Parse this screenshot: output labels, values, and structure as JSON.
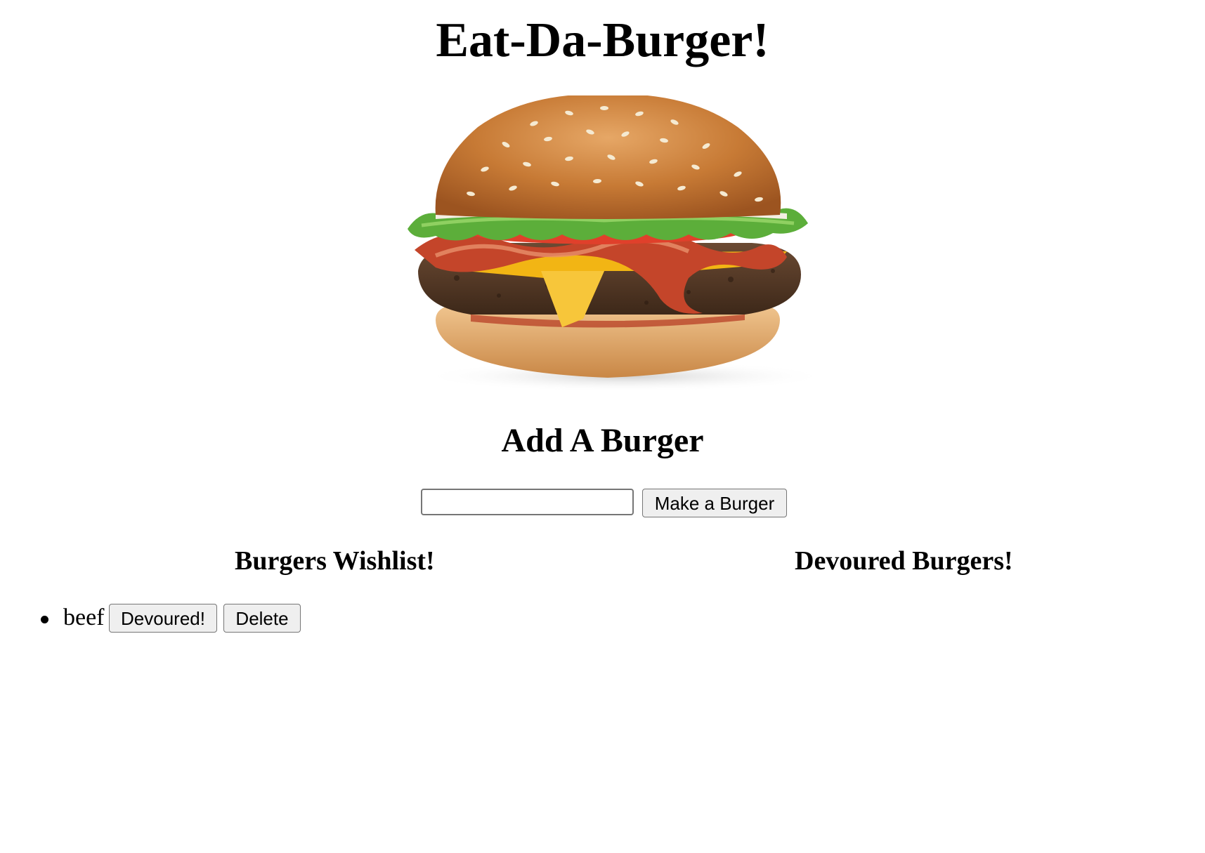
{
  "page": {
    "title": "Eat-Da-Burger!"
  },
  "hero_image": {
    "icon": "burger-image"
  },
  "add_section": {
    "heading": "Add A Burger",
    "input_value": "",
    "input_placeholder": "",
    "submit_label": "Make a Burger"
  },
  "wishlist": {
    "heading": "Burgers Wishlist!",
    "items": [
      {
        "name": "beef",
        "devour_label": "Devoured!",
        "delete_label": "Delete"
      }
    ]
  },
  "devoured": {
    "heading": "Devoured Burgers!",
    "items": []
  }
}
